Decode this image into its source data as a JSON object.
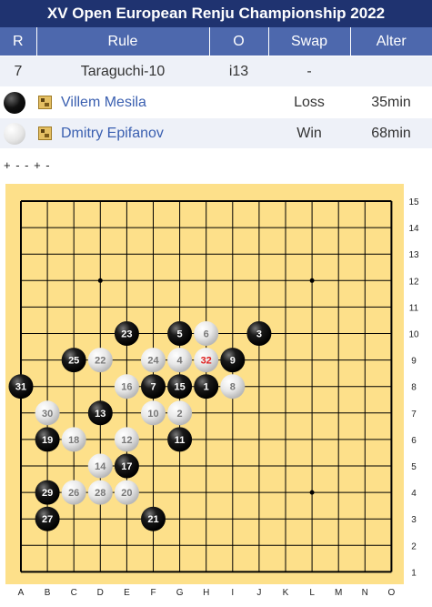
{
  "title": "XV Open European Renju Championship 2022",
  "info_table": {
    "headers": [
      "R",
      "Rule",
      "O",
      "Swap",
      "Alter"
    ],
    "round": "7",
    "rule": "Taraguchi-10",
    "opening": "i13",
    "swap": "-",
    "alter": ""
  },
  "players": [
    {
      "color": "black",
      "name": "Villem Mesila",
      "result": "Loss",
      "time": "35min"
    },
    {
      "color": "white",
      "name": "Dmitry Epifanov",
      "result": "Win",
      "time": "68min"
    }
  ],
  "controls": "+ - - + -",
  "board": {
    "columns": [
      "A",
      "B",
      "C",
      "D",
      "E",
      "F",
      "G",
      "H",
      "I",
      "J",
      "K",
      "L",
      "M",
      "N",
      "O"
    ],
    "rows": [
      "15",
      "14",
      "13",
      "12",
      "11",
      "10",
      "9",
      "8",
      "7",
      "6",
      "5",
      "4",
      "3",
      "2",
      "1"
    ],
    "star_points": [
      "D12",
      "L12",
      "L4"
    ],
    "last_move_color": "#e02020",
    "moves": [
      {
        "n": "1",
        "pos": "H8"
      },
      {
        "n": "2",
        "pos": "G7"
      },
      {
        "n": "3",
        "pos": "J10"
      },
      {
        "n": "4",
        "pos": "G9"
      },
      {
        "n": "5",
        "pos": "G10"
      },
      {
        "n": "6",
        "pos": "H10"
      },
      {
        "n": "7",
        "pos": "F8"
      },
      {
        "n": "8",
        "pos": "I8"
      },
      {
        "n": "9",
        "pos": "I9"
      },
      {
        "n": "10",
        "pos": "F7"
      },
      {
        "n": "11",
        "pos": "G6"
      },
      {
        "n": "12",
        "pos": "E6"
      },
      {
        "n": "13",
        "pos": "D7"
      },
      {
        "n": "14",
        "pos": "D5"
      },
      {
        "n": "15",
        "pos": "G8"
      },
      {
        "n": "16",
        "pos": "E8"
      },
      {
        "n": "17",
        "pos": "E5"
      },
      {
        "n": "18",
        "pos": "C6"
      },
      {
        "n": "19",
        "pos": "B6"
      },
      {
        "n": "20",
        "pos": "E4"
      },
      {
        "n": "21",
        "pos": "F3"
      },
      {
        "n": "22",
        "pos": "D9"
      },
      {
        "n": "23",
        "pos": "E10"
      },
      {
        "n": "24",
        "pos": "F9"
      },
      {
        "n": "25",
        "pos": "C9"
      },
      {
        "n": "26",
        "pos": "C4"
      },
      {
        "n": "27",
        "pos": "B3"
      },
      {
        "n": "28",
        "pos": "D4"
      },
      {
        "n": "29",
        "pos": "B4"
      },
      {
        "n": "30",
        "pos": "B7"
      },
      {
        "n": "31",
        "pos": "A8"
      },
      {
        "n": "32",
        "pos": "H9"
      }
    ]
  }
}
